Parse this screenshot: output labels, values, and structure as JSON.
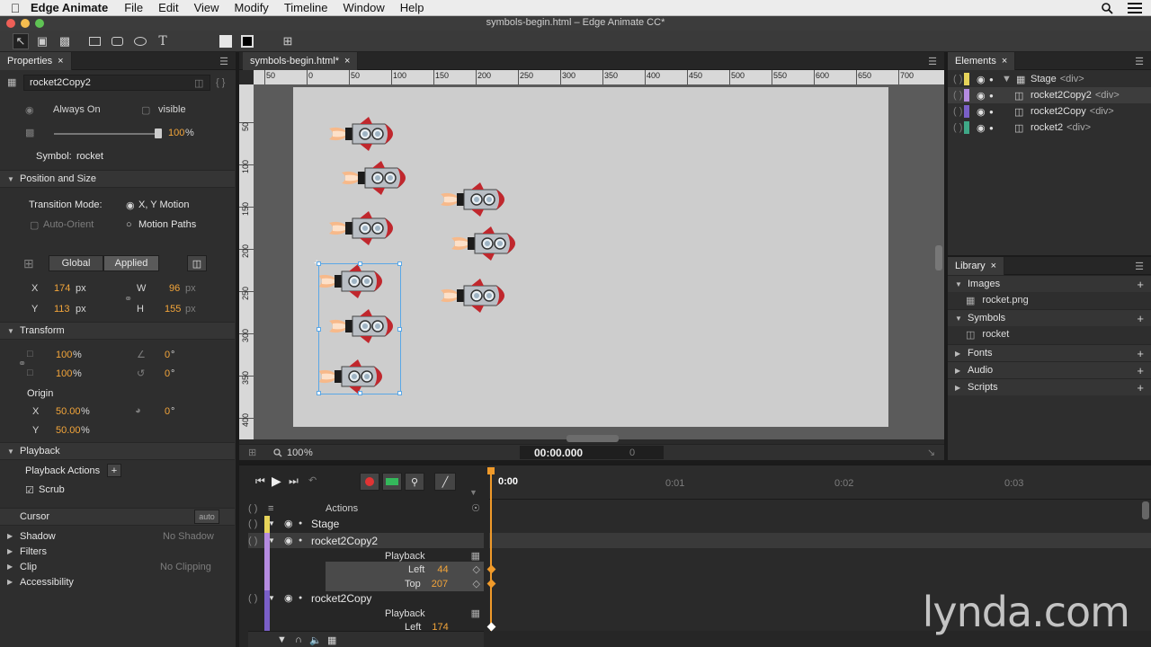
{
  "menubar": {
    "app": "Edge Animate",
    "items": [
      "File",
      "Edit",
      "View",
      "Modify",
      "Timeline",
      "Window",
      "Help"
    ]
  },
  "window": {
    "title": "symbols-begin.html – Edge Animate CC*"
  },
  "properties": {
    "tab": "Properties",
    "element_name": "rocket2Copy2",
    "overflow": "Always On",
    "visibility": "visible",
    "opacity": "100",
    "opacity_unit": "%",
    "symbol_label": "Symbol:",
    "symbol_name": "rocket",
    "position_section": "Position and Size",
    "transition_label": "Transition Mode:",
    "xy_motion": "X, Y Motion",
    "auto_orient": "Auto-Orient",
    "motion_paths": "Motion Paths",
    "global": "Global",
    "applied": "Applied",
    "x_label": "X",
    "x": "174",
    "x_unit": "px",
    "y_label": "Y",
    "y": "113",
    "y_unit": "px",
    "w_label": "W",
    "w": "96",
    "w_unit": "px",
    "h_label": "H",
    "h": "155",
    "h_unit": "px",
    "transform_section": "Transform",
    "scale_x": "100",
    "scale_y": "100",
    "pct": "%",
    "rotate": "0",
    "skew": "0",
    "deg": "°",
    "origin_label": "Origin",
    "origin_x_label": "X",
    "origin_x": "50.00",
    "origin_y_label": "Y",
    "origin_y": "50.00",
    "origin_rot": "0",
    "playback_section": "Playback",
    "playback_actions": "Playback Actions",
    "scrub": "Scrub",
    "cursor_section": "Cursor",
    "cursor_value": "auto",
    "shadow_section": "Shadow",
    "shadow_value": "No Shadow",
    "filters_section": "Filters",
    "clip_section": "Clip",
    "clip_value": "No Clipping",
    "accessibility_section": "Accessibility"
  },
  "document": {
    "tab": "symbols-begin.html*",
    "ruler_h": [
      "50",
      "0",
      "50",
      "100",
      "150",
      "200",
      "250",
      "300",
      "350",
      "400",
      "450",
      "500",
      "550",
      "600",
      "650",
      "700"
    ],
    "ruler_v": [
      "50",
      "100",
      "150",
      "200",
      "250",
      "300",
      "350",
      "400"
    ],
    "zoom": "100",
    "zoom_unit": "%",
    "time": "00:00.000",
    "frame": "0"
  },
  "elements": {
    "tab": "Elements",
    "rows": [
      {
        "name": "Stage",
        "tag": "<div>",
        "color": "#e6d35a"
      },
      {
        "name": "rocket2Copy2",
        "tag": "<div>",
        "color": "#b58be0"
      },
      {
        "name": "rocket2Copy",
        "tag": "<div>",
        "color": "#7a5fc8"
      },
      {
        "name": "rocket2",
        "tag": "<div>",
        "color": "#3fa887"
      }
    ]
  },
  "library": {
    "tab": "Library",
    "images": "Images",
    "image_item": "rocket.png",
    "symbols": "Symbols",
    "symbol_item": "rocket",
    "fonts": "Fonts",
    "audio": "Audio",
    "scripts": "Scripts"
  },
  "timeline": {
    "time_marks": [
      "0:00",
      "0:01",
      "0:02",
      "0:03"
    ],
    "actions": "Actions",
    "stage": "Stage",
    "rocket2Copy2": "rocket2Copy2",
    "playback1": "Playback",
    "left_label": "Left",
    "left_value": "44",
    "top_label": "Top",
    "top_value": "207",
    "rocket2Copy": "rocket2Copy",
    "playback2": "Playback",
    "left2_label": "Left",
    "left2_value": "174"
  },
  "watermark": "lynda.com"
}
